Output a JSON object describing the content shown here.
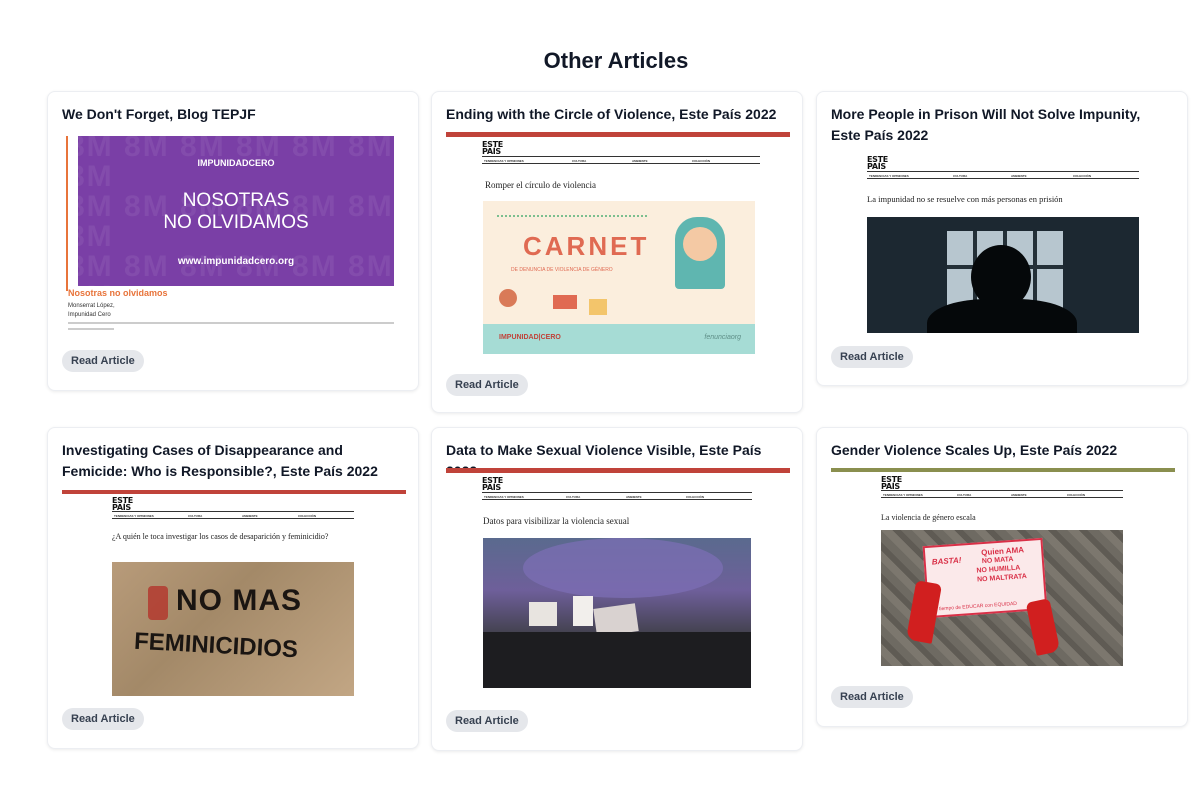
{
  "page": {
    "heading": "Other Articles",
    "read_label": "Read Article"
  },
  "articles": [
    {
      "title": "We Don't Forget, Blog TEPJF",
      "thumb": {
        "brand": "IMPUNIDADCERO",
        "headline_line1": "NOSOTRAS",
        "headline_line2": "NO OLVIDAMOS",
        "url": "www.impunidadcero.org",
        "watermark": "8M",
        "caption": "Nosotras no olvidamos",
        "author_line1": "Monserrat López,",
        "author_line2": "Impunidad Cero"
      }
    },
    {
      "title": "Ending with the Circle of Violence, Este País 2022",
      "thumb": {
        "logo1": "ESTE",
        "logo2": "PAÍS",
        "article_title": "Romper el círculo de violencia",
        "carnet": "CARNET",
        "carnet_sub": "DE DENUNCIA DE VIOLENCIA DE GÉNERO",
        "brand": "IMPUNIDAD|CERO",
        "brand2": "fenunciaorg"
      }
    },
    {
      "title": "More People in Prison Will Not Solve Impunity, Este País 2022",
      "thumb": {
        "logo1": "ESTE",
        "logo2": "PAÍS",
        "article_title": "La impunidad no se resuelve con más personas en prisión"
      }
    },
    {
      "title": "Investigating Cases of Disappearance and Femicide: Who is Responsible?, Este País 2022",
      "thumb": {
        "logo1": "ESTE",
        "logo2": "PAÍS",
        "article_title": "¿A quién le toca investigar los casos de desaparición y feminicidio?",
        "graffiti1": "NO MAS",
        "graffiti2": "FEMINICIDIOS"
      }
    },
    {
      "title": "Data to Make Sexual Violence Visible, Este País 2022",
      "thumb": {
        "logo1": "ESTE",
        "logo2": "PAÍS",
        "article_title": "Datos para visibilizar la violencia sexual"
      }
    },
    {
      "title": "Gender Violence Scales Up, Este País 2022",
      "thumb": {
        "logo1": "ESTE",
        "logo2": "PAÍS",
        "article_title": "La violencia de género escala",
        "sign1": "Quien AMA",
        "sign2": "NO MATA",
        "sign3": "NO HUMILLA",
        "sign4": "NO MALTRATA",
        "basta": "BASTA!",
        "sign_footer": "tiempo de EDUCAR con EQUIDAD"
      }
    }
  ],
  "nav": {
    "tendencias": "TENDENCIAS Y OPINIONES",
    "cultura": "CULTURA",
    "ambiente": "AMBIENTE",
    "coleccion": "COLECCIÓN"
  },
  "colors": {
    "purple": "#7a3fa6",
    "orange_accent": "#e8743b",
    "red_bar": "#c0433a",
    "olive_bar": "#8a8f4f"
  }
}
